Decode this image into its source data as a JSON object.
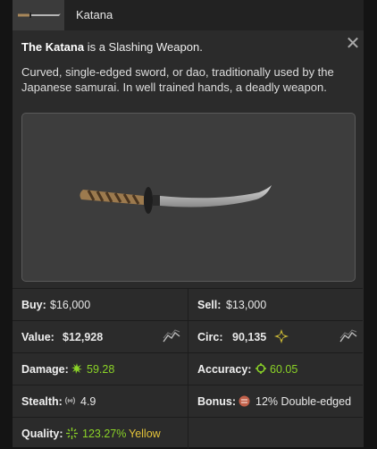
{
  "header": {
    "title": "Katana"
  },
  "description": {
    "name": "The Katana",
    "type_text": " is a Slashing Weapon.",
    "text": "Curved, single-edged sword, or dao, traditionally used by the Japanese samurai. In well trained hands, a deadly weapon."
  },
  "stats": {
    "buy_label": "Buy:",
    "buy_value": "$16,000",
    "sell_label": "Sell:",
    "sell_value": "$13,000",
    "value_label": "Value:",
    "value_value": "$12,928",
    "circ_label": "Circ:",
    "circ_value": "90,135",
    "damage_label": "Damage:",
    "damage_value": "59.28",
    "accuracy_label": "Accuracy:",
    "accuracy_value": "60.05",
    "stealth_label": "Stealth:",
    "stealth_value": "4.9",
    "bonus_label": "Bonus:",
    "bonus_value": "12% Double-edged",
    "quality_label": "Quality:",
    "quality_value": "123.27%",
    "quality_tier": "Yellow"
  },
  "icons": {
    "close": "close-icon",
    "trend": "trend-chart-icon",
    "damage": "damage-burst-icon",
    "accuracy": "crosshair-icon",
    "stealth": "noise-icon",
    "bonus": "bonus-badge-icon",
    "circ": "diamond-star-icon",
    "quality": "sparkle-icon"
  },
  "colors": {
    "green_stat": "#8bd327",
    "yellow_quality": "#e3c33a",
    "panel_bg": "#2b2b2b"
  }
}
